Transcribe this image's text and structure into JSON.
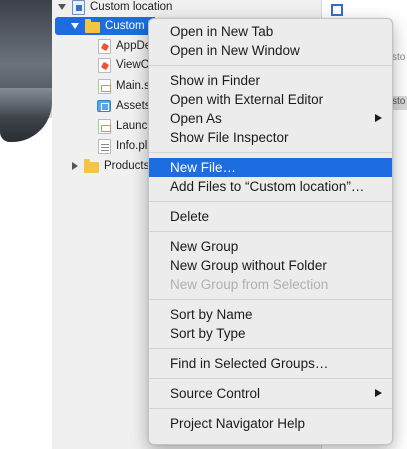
{
  "navigator": {
    "rows": [
      {
        "label": "Custom location",
        "icon": "project-file-icon"
      },
      {
        "label": "Custom lo",
        "icon": "folder-icon"
      },
      {
        "label": "AppDe",
        "icon": "swift-file-icon"
      },
      {
        "label": "ViewC",
        "icon": "swift-file-icon"
      },
      {
        "label": "Main.s",
        "icon": "storyboard-file-icon"
      },
      {
        "label": "Assets",
        "icon": "asset-catalog-icon"
      },
      {
        "label": "Launch",
        "icon": "storyboard-file-icon"
      },
      {
        "label": "Info.pl",
        "icon": "plist-file-icon"
      },
      {
        "label": "Products",
        "icon": "folder-icon"
      }
    ]
  },
  "editor": {
    "strip_texts": [
      "sto",
      "sto"
    ]
  },
  "menu": {
    "groups": [
      [
        "Open in New Tab",
        "Open in New Window"
      ],
      [
        "Show in Finder",
        "Open with External Editor",
        "Open As",
        "Show File Inspector"
      ],
      [
        "New File…",
        "Add Files to “Custom location”…"
      ],
      [
        "Delete"
      ],
      [
        "New Group",
        "New Group without Folder",
        "New Group from Selection"
      ],
      [
        "Sort by Name",
        "Sort by Type"
      ],
      [
        "Find in Selected Groups…"
      ],
      [
        "Source Control"
      ],
      [
        "Project Navigator Help"
      ]
    ],
    "highlighted_item": "New File…",
    "disabled_items": [
      "New Group from Selection"
    ],
    "submenu_items": [
      "Open As",
      "Source Control"
    ]
  },
  "colors": {
    "selection_blue": "#1d6de0",
    "menu_background": "#ececec",
    "disabled_text": "#b0b0b0"
  }
}
